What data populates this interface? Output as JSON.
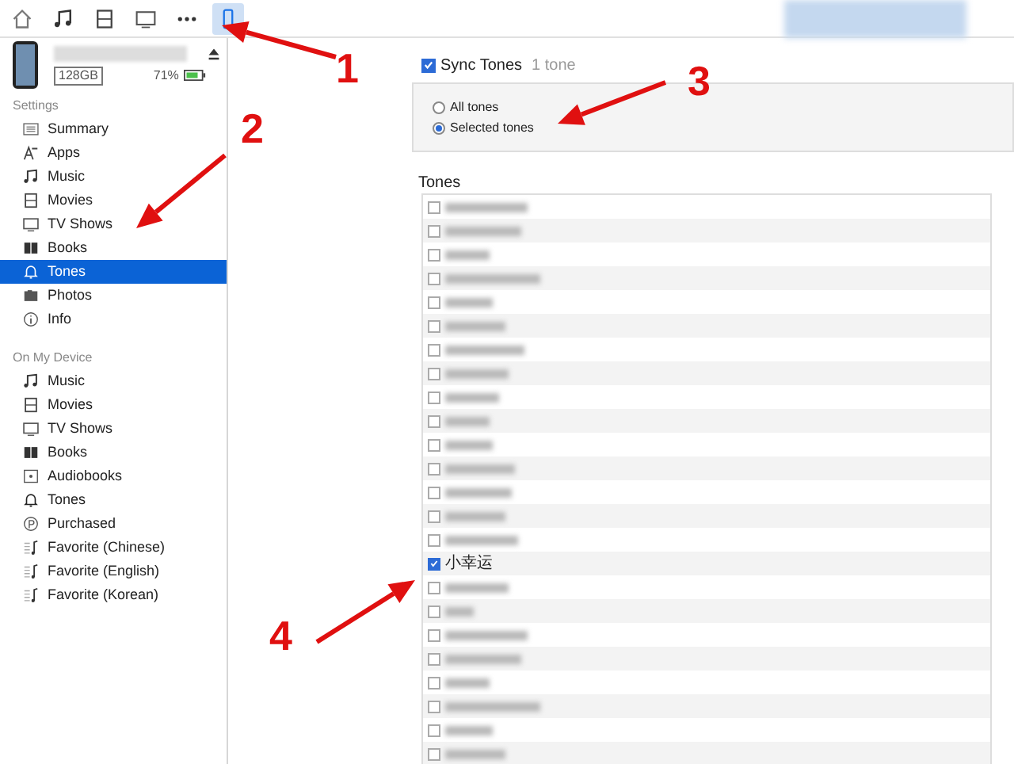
{
  "toolbar": {
    "buttons": [
      {
        "kind": "home",
        "selected": false
      },
      {
        "kind": "music",
        "selected": false
      },
      {
        "kind": "movies",
        "selected": false
      },
      {
        "kind": "tv",
        "selected": false
      },
      {
        "kind": "more",
        "selected": false
      },
      {
        "kind": "device",
        "selected": true
      }
    ]
  },
  "device": {
    "capacity": "128GB",
    "battery": "71%"
  },
  "settings": {
    "heading": "Settings",
    "items": [
      {
        "label": "Summary",
        "kind": "summary",
        "selected": false
      },
      {
        "label": "Apps",
        "kind": "apps",
        "selected": false
      },
      {
        "label": "Music",
        "kind": "music",
        "selected": false
      },
      {
        "label": "Movies",
        "kind": "movies",
        "selected": false
      },
      {
        "label": "TV Shows",
        "kind": "tv",
        "selected": false
      },
      {
        "label": "Books",
        "kind": "books",
        "selected": false
      },
      {
        "label": "Tones",
        "kind": "bell",
        "selected": true
      },
      {
        "label": "Photos",
        "kind": "photos",
        "selected": false
      },
      {
        "label": "Info",
        "kind": "info",
        "selected": false
      }
    ]
  },
  "on_my_device": {
    "heading": "On My Device",
    "items": [
      {
        "label": "Music",
        "kind": "music",
        "selected": false
      },
      {
        "label": "Movies",
        "kind": "movies",
        "selected": false
      },
      {
        "label": "TV Shows",
        "kind": "tv",
        "selected": false
      },
      {
        "label": "Books",
        "kind": "books",
        "selected": false
      },
      {
        "label": "Audiobooks",
        "kind": "audiobook",
        "selected": false
      },
      {
        "label": "Tones",
        "kind": "bell",
        "selected": false
      },
      {
        "label": "Purchased",
        "kind": "purchased",
        "selected": false
      },
      {
        "label": "Favorite (Chinese)",
        "kind": "playlist",
        "selected": false
      },
      {
        "label": "Favorite (English)",
        "kind": "playlist",
        "selected": false
      },
      {
        "label": "Favorite (Korean)",
        "kind": "playlist",
        "selected": false
      }
    ]
  },
  "sync": {
    "label": "Sync Tones",
    "checked": true,
    "count": "1 tone",
    "options": [
      {
        "label": "All tones",
        "selected": false
      },
      {
        "label": "Selected tones",
        "selected": true
      }
    ]
  },
  "tones": {
    "heading": "Tones",
    "items": [
      {
        "checked": false
      },
      {
        "checked": false
      },
      {
        "checked": false
      },
      {
        "checked": false
      },
      {
        "checked": false
      },
      {
        "checked": false
      },
      {
        "checked": false
      },
      {
        "checked": false
      },
      {
        "checked": false
      },
      {
        "checked": false
      },
      {
        "checked": false
      },
      {
        "checked": false
      },
      {
        "checked": false
      },
      {
        "checked": false
      },
      {
        "checked": false
      },
      {
        "checked": true,
        "name": "小幸运"
      },
      {
        "checked": false
      },
      {
        "checked": false
      },
      {
        "checked": false
      },
      {
        "checked": false
      },
      {
        "checked": false
      },
      {
        "checked": false
      },
      {
        "checked": false
      },
      {
        "checked": false
      }
    ]
  },
  "annotations": [
    {
      "label": "1"
    },
    {
      "label": "2"
    },
    {
      "label": "3"
    },
    {
      "label": "4"
    }
  ]
}
